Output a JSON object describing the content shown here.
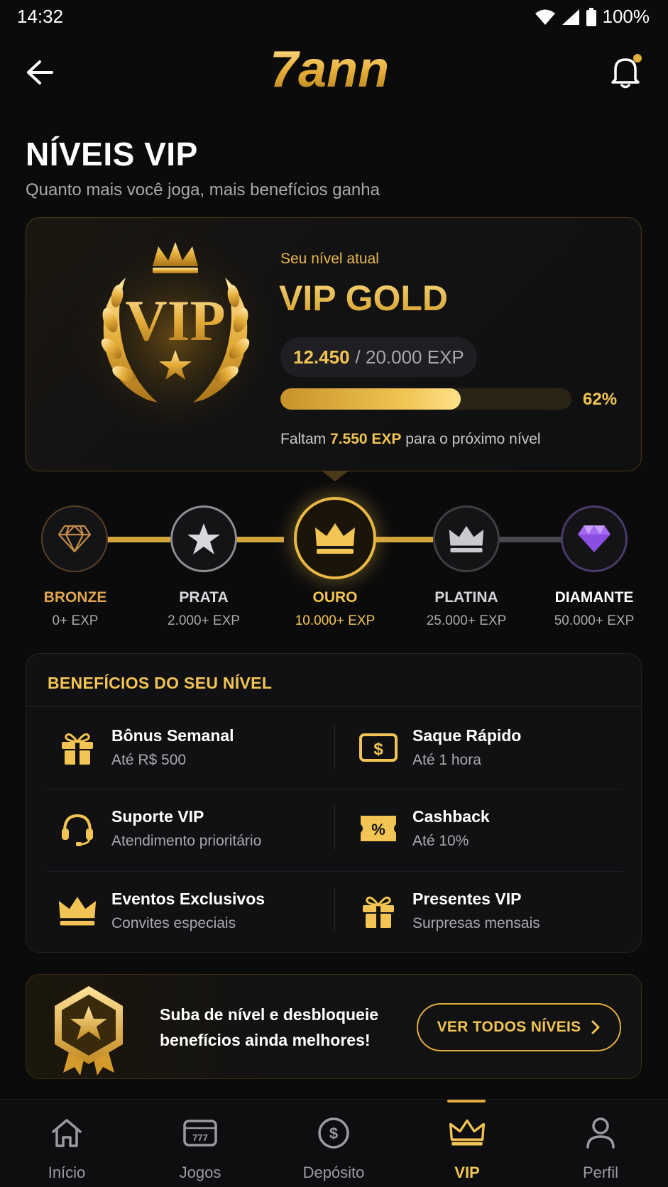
{
  "status_bar": {
    "time": "14:32",
    "battery": "100%"
  },
  "header": {
    "logo_text": "7ann"
  },
  "page": {
    "title": "NÍVEIS VIP",
    "subtitle": "Quanto mais você joga, mais benefícios ganha"
  },
  "current_level": {
    "emblem_text": "VIP",
    "label": "Seu nível atual",
    "name": "VIP GOLD",
    "exp_current": "12.450",
    "exp_total": "/ 20.000 EXP",
    "progress_percent_text": "62%",
    "progress_fraction": 0.62,
    "remaining_prefix": "Faltam",
    "remaining_value": "7.550 EXP",
    "remaining_suffix": "para o próximo nível"
  },
  "tiers": [
    {
      "name": "BRONZE",
      "exp": "0+ EXP",
      "icon": "diamond-outline-icon",
      "color": "#e0a550"
    },
    {
      "name": "PRATA",
      "exp": "2.000+ EXP",
      "icon": "star-icon",
      "color": "#d9d9dd"
    },
    {
      "name": "OURO",
      "exp": "10.000+ EXP",
      "icon": "crown-icon",
      "color": "#f2c453"
    },
    {
      "name": "PLATINA",
      "exp": "25.000+ EXP",
      "icon": "crown-icon",
      "color": "#c9c9cf"
    },
    {
      "name": "DIAMANTE",
      "exp": "50.000+ EXP",
      "icon": "diamond-icon",
      "color": "#ffffff"
    }
  ],
  "benefits": {
    "title": "BENEFÍCIOS DO SEU NÍVEL",
    "items": [
      {
        "title": "Bônus Semanal",
        "desc": "Até R$ 500",
        "icon": "gift-icon"
      },
      {
        "title": "Saque Rápido",
        "desc": "Até 1 hora",
        "icon": "cash-icon"
      },
      {
        "title": "Suporte VIP",
        "desc": "Atendimento prioritário",
        "icon": "headset-icon"
      },
      {
        "title": "Cashback",
        "desc": "Até 10%",
        "icon": "percent-ticket-icon"
      },
      {
        "title": "Eventos Exclusivos",
        "desc": "Convites especiais",
        "icon": "crown-icon"
      },
      {
        "title": "Presentes VIP",
        "desc": "Surpresas mensais",
        "icon": "gift-icon"
      }
    ]
  },
  "promo": {
    "text": "Suba de nível e desbloqueie benefícios ainda melhores!",
    "button": "VER TODOS NÍVEIS"
  },
  "nav": [
    {
      "label": "Início",
      "icon": "home-icon",
      "active": false
    },
    {
      "label": "Jogos",
      "icon": "slot-machine-icon",
      "active": false
    },
    {
      "label": "Depósito",
      "icon": "dollar-circle-icon",
      "active": false
    },
    {
      "label": "VIP",
      "icon": "crown-icon",
      "active": true
    },
    {
      "label": "Perfil",
      "icon": "user-icon",
      "active": false
    }
  ],
  "colors": {
    "gold": "#f2c453",
    "background": "#0b0b0c",
    "muted": "#a9a9ad"
  }
}
